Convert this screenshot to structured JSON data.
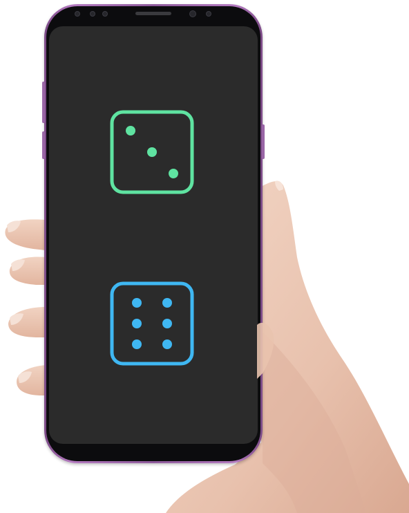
{
  "app": {
    "screen_background": "#2b2b2b"
  },
  "dice": [
    {
      "face_value": 3,
      "color": "#5fe3a1",
      "icon": "die-three-icon"
    },
    {
      "face_value": 6,
      "color": "#3fb7f2",
      "icon": "die-six-icon"
    }
  ],
  "device": {
    "frame_color": "#9a66a6"
  }
}
